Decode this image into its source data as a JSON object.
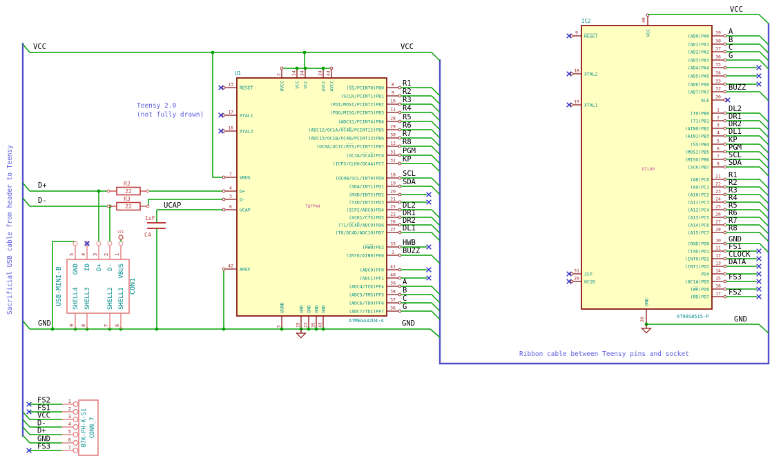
{
  "colors": {
    "wire": "#00a000",
    "bus": "#5050cc",
    "outline": "#8b1414",
    "fill": "#ffffc2",
    "connector": "#e27d7d",
    "device": "#c03a3a",
    "pin_name": "#008b8b",
    "pin_number": "#9c1a1a",
    "net_label": "#000000",
    "value_text": "#c2529d",
    "note_text": "#5c5ce0",
    "no_connect": "#2828c8"
  },
  "notes": {
    "sacrificial": "Sacrificial USB cable from header to Teensy",
    "teensy_line1": "Teensy 2.0",
    "teensy_line2": "(not fully drawn)",
    "ribbon": "Ribbon cable between Teensy pins and socket"
  },
  "labels": {
    "vcc": "VCC",
    "gnd": "GND",
    "dplus": "D+",
    "dminus": "D-",
    "ucap": "UCAP"
  },
  "u1": {
    "ref": "U1",
    "part": "ATMEGA32U4-A",
    "value": "TQFP44",
    "top_pins": [
      {
        "num": "2",
        "name": "UVCC"
      },
      {
        "num": "14",
        "name": "VCC"
      },
      {
        "num": "34",
        "name": "VCC"
      },
      {
        "num": "24",
        "name": "AVCC"
      },
      {
        "num": "44",
        "name": "AVCC"
      }
    ],
    "bottom_pins": [
      {
        "num": "5",
        "name": "UGND"
      },
      {
        "num": "15",
        "name": "GND"
      },
      {
        "num": "23",
        "name": "GND"
      },
      {
        "num": "35",
        "name": "GND"
      },
      {
        "num": "43",
        "name": "GND"
      }
    ],
    "left_pins": [
      {
        "num": "13",
        "name": "R̅E̅S̅E̅T̅",
        "end": "nc"
      },
      {
        "num": "17",
        "name": "XTAL1",
        "end": "nc"
      },
      {
        "num": "16",
        "name": "XTAL2",
        "end": "nc"
      },
      {
        "num": "7",
        "name": "VBUS",
        "end": "wire"
      },
      {
        "num": "4",
        "name": "D+",
        "end": "wire"
      },
      {
        "num": "3",
        "name": "D-",
        "end": "wire"
      },
      {
        "num": "6",
        "name": "UCAP",
        "end": "wire"
      },
      {
        "num": "42",
        "name": "AREF",
        "end": "wire"
      }
    ],
    "right_pins": [
      {
        "num": "8",
        "name": "(S̅S̅/PCINT0)PB0",
        "label": "R1",
        "end": "bus"
      },
      {
        "num": "9",
        "name": "(SCLK/PCINT1)PB1",
        "label": "R2",
        "end": "bus"
      },
      {
        "num": "10",
        "name": "(PDI/MOSI/PCINT2)PB2",
        "label": "R3",
        "end": "bus"
      },
      {
        "num": "11",
        "name": "(PDO/MISO/PCINT3)PB3",
        "label": "R4",
        "end": "bus"
      },
      {
        "num": "28",
        "name": "(ADC11/PCINT4)PB4",
        "label": "R5",
        "end": "bus"
      },
      {
        "num": "29",
        "name": "(ADC12/OC1A/O̅C̅4̅B̅/PCINT12)PB5",
        "label": "R6",
        "end": "bus"
      },
      {
        "num": "30",
        "name": "(ADC13/OC1B/OC4B/PCINT13)PB6",
        "label": "R7",
        "end": "bus"
      },
      {
        "num": "12",
        "name": "(OC0A/OC1C/R̅T̅S̅/PCINT7)PB7",
        "label": "R8",
        "end": "bus"
      },
      {
        "num": "31",
        "name": "(OC3A/O̅C̅4̅A̅)PC6",
        "label": "PGM",
        "end": "bus"
      },
      {
        "num": "32",
        "name": "(ICP3/CLK0/OC4A)PC7",
        "label": "KP",
        "end": "bus"
      },
      {
        "num": "18",
        "name": "(OC0B/SCL/INT0)PD0",
        "label": "SCL",
        "end": "bus"
      },
      {
        "num": "19",
        "name": "(SDA/INT1)PD1",
        "label": "SDA",
        "end": "bus"
      },
      {
        "num": "20",
        "name": "(RXD/INT2)PD2",
        "label": "",
        "end": "nc"
      },
      {
        "num": "21",
        "name": "(TXD/INT3)PD3",
        "label": "",
        "end": "nc"
      },
      {
        "num": "25",
        "name": "(ICP2/ADC8)PD4",
        "label": "DL2",
        "end": "bus"
      },
      {
        "num": "22",
        "name": "(XCK1/C̅T̅S̅)PD5",
        "label": "DR1",
        "end": "bus"
      },
      {
        "num": "26",
        "name": "(T1/O̅C̅4̅D̅/ADC9)PD6",
        "label": "DR2",
        "end": "bus"
      },
      {
        "num": "27",
        "name": "(T0/OC4D/ADC10)PD7",
        "label": "DL1",
        "end": "bus"
      },
      {
        "num": "33",
        "name": "(H̅W̅B̅)PE2",
        "label": "HWB",
        "end": "nclabel"
      },
      {
        "num": "1",
        "name": "(INT6/AIN0)PE6",
        "label": "BUZZ",
        "end": "bus"
      },
      {
        "num": "41",
        "name": "(ADC0)PF0",
        "label": "",
        "end": "nc"
      },
      {
        "num": "40",
        "name": "(ADC1)PF1",
        "label": "",
        "end": "nc"
      },
      {
        "num": "39",
        "name": "(ADC4/TCK)PF4",
        "label": "A",
        "end": "bus"
      },
      {
        "num": "38",
        "name": "(ADC5/TMS)PF5",
        "label": "B",
        "end": "bus"
      },
      {
        "num": "37",
        "name": "(ADC6/TDO)PF6",
        "label": "C",
        "end": "bus"
      },
      {
        "num": "36",
        "name": "(ADC7/TDI)PF7",
        "label": "G",
        "end": "bus"
      }
    ]
  },
  "ic2": {
    "ref": "IC2",
    "part": "AT90S8515-P",
    "value": "DIL40",
    "top_pins": [
      {
        "num": "40",
        "name": "VCC"
      }
    ],
    "bottom_pins": [
      {
        "num": "20",
        "name": "GND"
      }
    ],
    "left_pins": [
      {
        "num": "9",
        "name": "R̅E̅S̅E̅T̅",
        "end": "nc"
      },
      {
        "num": "18",
        "name": "XTAL2",
        "end": "nc"
      },
      {
        "num": "19",
        "name": "XTAL1",
        "end": "nc"
      },
      {
        "num": "31",
        "name": "ICP",
        "end": "nc"
      },
      {
        "num": "29",
        "name": "OC1B",
        "end": "nc"
      }
    ],
    "right_pins": [
      {
        "num": "39",
        "name": "(AD0)PA0",
        "label": "A",
        "end": "bus"
      },
      {
        "num": "38",
        "name": "(AD1)PA1",
        "label": "B",
        "end": "bus"
      },
      {
        "num": "37",
        "name": "(AD2)PA2",
        "label": "C",
        "end": "bus"
      },
      {
        "num": "36",
        "name": "(AD3)PA3",
        "label": "G",
        "end": "bus"
      },
      {
        "num": "35",
        "name": "(AD4)PA4",
        "label": "",
        "end": "nc"
      },
      {
        "num": "34",
        "name": "(AD5)PA5",
        "label": "",
        "end": "nc"
      },
      {
        "num": "33",
        "name": "(AD6)PA6",
        "label": "",
        "end": "nc"
      },
      {
        "num": "32",
        "name": "(AD7)PA7",
        "label": "BUZZ",
        "end": "bus"
      },
      {
        "num": "30",
        "name": "ALE",
        "label": "",
        "end": "ncpin"
      },
      {
        "num": "1",
        "name": "(T0)PB0",
        "label": "DL2",
        "end": "bus"
      },
      {
        "num": "2",
        "name": "(T1)PB1",
        "label": "DR1",
        "end": "bus"
      },
      {
        "num": "3",
        "name": "(AIN0)PB2",
        "label": "DR2",
        "end": "bus"
      },
      {
        "num": "4",
        "name": "(AIN1)PB3",
        "label": "DL1",
        "end": "bus"
      },
      {
        "num": "5",
        "name": "(S̅S̅)PB4",
        "label": "KP",
        "end": "bus"
      },
      {
        "num": "6",
        "name": "(MOSI)PB5",
        "label": "PGM",
        "end": "bus"
      },
      {
        "num": "7",
        "name": "(MISO)PB6",
        "label": "SCL",
        "end": "bus"
      },
      {
        "num": "8",
        "name": "(SCK)PB7",
        "label": "SDA",
        "end": "bus"
      },
      {
        "num": "21",
        "name": "(A8)PC0",
        "label": "R1",
        "end": "bus"
      },
      {
        "num": "22",
        "name": "(A9)PC1",
        "label": "R2",
        "end": "bus"
      },
      {
        "num": "23",
        "name": "(A10)PC2",
        "label": "R3",
        "end": "bus"
      },
      {
        "num": "24",
        "name": "(A11)PC3",
        "label": "R4",
        "end": "bus"
      },
      {
        "num": "25",
        "name": "(A12)PC4",
        "label": "R5",
        "end": "bus"
      },
      {
        "num": "26",
        "name": "(A13)PC5",
        "label": "R6",
        "end": "bus"
      },
      {
        "num": "27",
        "name": "(A14)PC6",
        "label": "R7",
        "end": "bus"
      },
      {
        "num": "28",
        "name": "(A15)PC7",
        "label": "R8",
        "end": "bus"
      },
      {
        "num": "10",
        "name": "(RXD)PD0",
        "label": "GND",
        "end": "bus"
      },
      {
        "num": "11",
        "name": "(TXD)PD1",
        "label": "FS1",
        "end": "nclabel"
      },
      {
        "num": "12",
        "name": "(INT0)PD2",
        "label": "CLOCK",
        "end": "nclabel"
      },
      {
        "num": "13",
        "name": "(INT1)PD3",
        "label": "DATA",
        "end": "nclabel"
      },
      {
        "num": "14",
        "name": "PD4",
        "label": "",
        "end": "nc"
      },
      {
        "num": "15",
        "name": "(OC1A)PD5",
        "label": "FS3",
        "end": "nclabel"
      },
      {
        "num": "16",
        "name": "(W̅R̅)PD6",
        "label": "",
        "end": "nc"
      },
      {
        "num": "17",
        "name": "(R̅D̅)PD7",
        "label": "FS2",
        "end": "nclabel"
      }
    ]
  },
  "con1": {
    "ref": "CON1",
    "part": "USB-MINI-B",
    "top_pins": [
      {
        "num": "5",
        "name": "GND"
      },
      {
        "num": "4",
        "name": "ID",
        "end": "nc"
      },
      {
        "num": "3",
        "name": "D+"
      },
      {
        "num": "2",
        "name": "D-"
      },
      {
        "num": "1",
        "name": "VBUS",
        "end": "vcc"
      }
    ],
    "bottom_pins": [
      {
        "num": "9",
        "name": "SHELL4"
      },
      {
        "num": "8",
        "name": "SHELL3"
      },
      {
        "num": "7",
        "name": "SHELL2"
      },
      {
        "num": "6",
        "name": "SHELL1"
      }
    ]
  },
  "conn7": {
    "ref": "CONN_7",
    "part": "B7K-PH-K-S1",
    "pins": [
      {
        "num": "1",
        "label": "FS2",
        "end": "nc"
      },
      {
        "num": "2",
        "label": "FS1",
        "end": "nc"
      },
      {
        "num": "3",
        "label": "VCC",
        "end": "bus"
      },
      {
        "num": "4",
        "label": "D-",
        "end": "bus"
      },
      {
        "num": "5",
        "label": "D+",
        "end": "bus"
      },
      {
        "num": "6",
        "label": "GND",
        "end": "bus"
      },
      {
        "num": "7",
        "label": "FS3",
        "end": "nc"
      }
    ]
  },
  "r2": {
    "ref": "R2",
    "value": "22"
  },
  "r3": {
    "ref": "R3",
    "value": "22"
  },
  "c4": {
    "ref": "C4",
    "value": "1uF"
  }
}
